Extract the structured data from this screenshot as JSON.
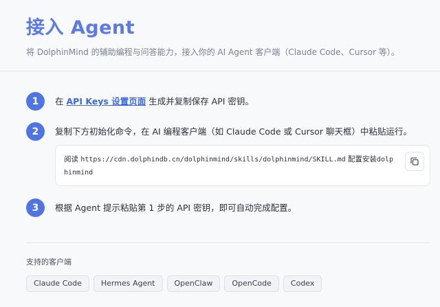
{
  "header": {
    "title": "接入 Agent",
    "subtitle": "将 DolphinMind 的辅助编程与问答能力，接入你的 AI Agent 客户端（Claude Code、Cursor 等）。"
  },
  "steps": [
    {
      "number": "1",
      "prefix": "在 ",
      "link": "API Keys 设置页面",
      "suffix": " 生成并复制保存 API 密钥。"
    },
    {
      "number": "2",
      "text": "复制下方初始化命令，在 AI 编程客户端（如 Claude Code 或 Cursor 聊天框）中粘贴运行。"
    },
    {
      "number": "3",
      "text": "根据 Agent 提示粘贴第 1 步的 API 密钥，即可自动完成配置。"
    }
  ],
  "command": {
    "prefix": "阅读 ",
    "url": "https://cdn.dolphindb.cn/dolphinmind/skills/dolphinmind/SKILL.md",
    "middle": " 配置安装",
    "tail": "dolphinmind"
  },
  "icons": {
    "copy": "copy-icon"
  },
  "clients": {
    "label": "支持的客户端",
    "items": [
      "Claude Code",
      "Hermes Agent",
      "OpenClaw",
      "OpenCode",
      "Codex"
    ]
  },
  "colors": {
    "accent": "#4f74e3",
    "title": "#5b7ae6",
    "link": "#3f6ae0"
  }
}
